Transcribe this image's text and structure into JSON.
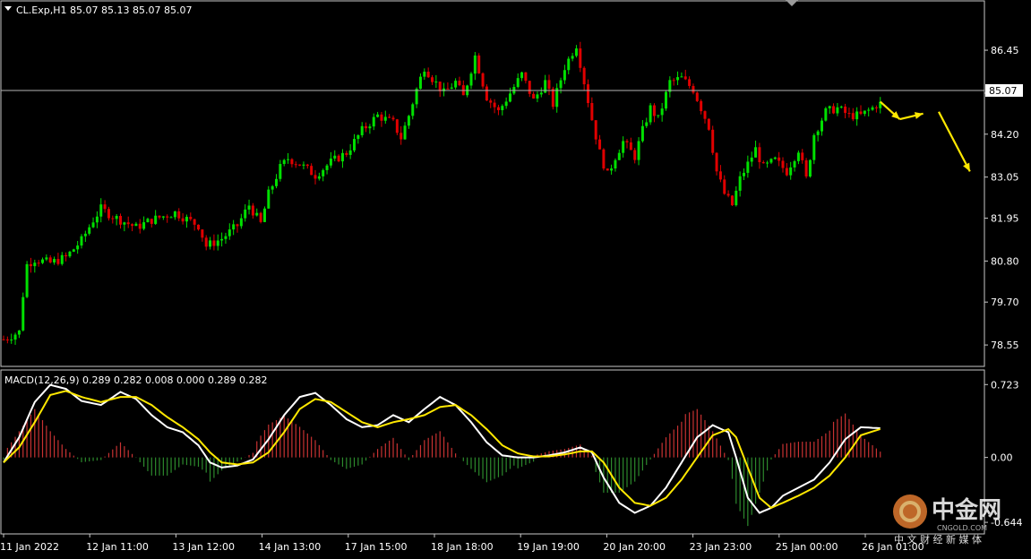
{
  "symbol_header": "CL.Exp,H1  85.07 85.13 85.07 85.07",
  "current_price_label": "85.07",
  "macd_header": "MACD(12,26,9) 0.289 0.282 0.008 0.000 0.289 0.282",
  "watermark": {
    "cn_text": "中金网",
    "sub_text": "CNGOLD.COM",
    "tagline": "中 文 财 经 新 媒 体"
  },
  "colors": {
    "background": "#000000",
    "bull_candle": "#00e000",
    "bear_candle": "#e00000",
    "macd_line": "#ffffff",
    "signal_line": "#ffe800",
    "hist_pos": "#c83232",
    "hist_neg": "#2d8a2d",
    "arrow": "#ffe800",
    "grid_text": "#ffffff"
  },
  "chart_data": [
    {
      "type": "candlestick",
      "price_axis_ticks": [
        "86.45",
        "85.30",
        "84.20",
        "83.05",
        "81.95",
        "80.80",
        "79.70",
        "78.55"
      ],
      "time_axis_labels": [
        "11 Jan 2022",
        "12 Jan 11:00",
        "13 Jan 12:00",
        "14 Jan 13:00",
        "17 Jan 15:00",
        "18 Jan 18:00",
        "19 Jan 19:00",
        "20 Jan 20:00",
        "23 Jan 23:00",
        "25 Jan 00:00",
        "26 Jan 01:00"
      ],
      "ylim": [
        78.0,
        87.7
      ],
      "current_price": 85.07,
      "close_path": [
        [
          0,
          78.7
        ],
        [
          4,
          78.9
        ],
        [
          5,
          79.9
        ],
        [
          6,
          80.7
        ],
        [
          8,
          80.85
        ],
        [
          12,
          80.75
        ],
        [
          16,
          80.9
        ],
        [
          20,
          81.35
        ],
        [
          23,
          81.9
        ],
        [
          25,
          82.2
        ],
        [
          28,
          82.0
        ],
        [
          34,
          81.7
        ],
        [
          38,
          81.9
        ],
        [
          44,
          82.1
        ],
        [
          50,
          81.75
        ],
        [
          52,
          81.2
        ],
        [
          56,
          81.4
        ],
        [
          60,
          81.75
        ],
        [
          63,
          82.3
        ],
        [
          66,
          81.8
        ],
        [
          68,
          82.6
        ],
        [
          71,
          83.3
        ],
        [
          73,
          83.55
        ],
        [
          76,
          83.4
        ],
        [
          80,
          83.1
        ],
        [
          84,
          83.45
        ],
        [
          88,
          83.7
        ],
        [
          92,
          84.3
        ],
        [
          96,
          84.7
        ],
        [
          100,
          84.5
        ],
        [
          102,
          84.1
        ],
        [
          104,
          84.7
        ],
        [
          106,
          85.4
        ],
        [
          108,
          86.0
        ],
        [
          110,
          85.7
        ],
        [
          113,
          85.3
        ],
        [
          116,
          85.6
        ],
        [
          118,
          85.2
        ],
        [
          121,
          86.3
        ],
        [
          124,
          85.2
        ],
        [
          127,
          84.8
        ],
        [
          130,
          85.3
        ],
        [
          133,
          85.8
        ],
        [
          136,
          85.1
        ],
        [
          139,
          85.6
        ],
        [
          141,
          85.0
        ],
        [
          144,
          86.0
        ],
        [
          147,
          86.6
        ],
        [
          149,
          85.6
        ],
        [
          151,
          84.6
        ],
        [
          153,
          83.7
        ],
        [
          155,
          83.1
        ],
        [
          157,
          83.6
        ],
        [
          159,
          84.0
        ],
        [
          162,
          83.6
        ],
        [
          164,
          84.3
        ],
        [
          166,
          84.9
        ],
        [
          168,
          84.6
        ],
        [
          171,
          85.6
        ],
        [
          174,
          85.7
        ],
        [
          177,
          85.4
        ],
        [
          181,
          84.4
        ],
        [
          183,
          83.2
        ],
        [
          185,
          82.6
        ],
        [
          187,
          82.3
        ],
        [
          189,
          83.0
        ],
        [
          191,
          83.4
        ],
        [
          193,
          83.8
        ],
        [
          195,
          83.3
        ],
        [
          198,
          83.5
        ],
        [
          201,
          83.2
        ],
        [
          204,
          83.8
        ],
        [
          206,
          83.0
        ],
        [
          208,
          84.2
        ],
        [
          211,
          84.8
        ],
        [
          214,
          84.9
        ],
        [
          217,
          84.7
        ],
        [
          220,
          84.7
        ],
        [
          223,
          84.9
        ],
        [
          225,
          85.07
        ]
      ],
      "up_days_count": 0,
      "forecast_arrows": [
        [
          [
            225,
            85.07
          ],
          [
            230,
            84.6
          ]
        ],
        [
          [
            230,
            84.6
          ],
          [
            236,
            84.75
          ]
        ],
        [
          [
            240,
            84.8
          ],
          [
            248,
            83.2
          ]
        ]
      ]
    },
    {
      "type": "macd",
      "ylim": [
        -0.75,
        0.85
      ],
      "axis_ticks": [
        "0.723",
        "0.00",
        "-0.644"
      ],
      "macd_path": [
        [
          0,
          -0.05
        ],
        [
          4,
          0.2
        ],
        [
          8,
          0.55
        ],
        [
          12,
          0.72
        ],
        [
          16,
          0.68
        ],
        [
          20,
          0.56
        ],
        [
          25,
          0.52
        ],
        [
          30,
          0.65
        ],
        [
          34,
          0.58
        ],
        [
          38,
          0.42
        ],
        [
          42,
          0.3
        ],
        [
          46,
          0.25
        ],
        [
          50,
          0.12
        ],
        [
          53,
          -0.05
        ],
        [
          56,
          -0.1
        ],
        [
          60,
          -0.08
        ],
        [
          64,
          -0.02
        ],
        [
          68,
          0.18
        ],
        [
          72,
          0.42
        ],
        [
          76,
          0.6
        ],
        [
          80,
          0.64
        ],
        [
          84,
          0.52
        ],
        [
          88,
          0.38
        ],
        [
          92,
          0.3
        ],
        [
          96,
          0.32
        ],
        [
          100,
          0.42
        ],
        [
          104,
          0.35
        ],
        [
          108,
          0.48
        ],
        [
          112,
          0.6
        ],
        [
          116,
          0.52
        ],
        [
          120,
          0.35
        ],
        [
          124,
          0.15
        ],
        [
          128,
          0.02
        ],
        [
          132,
          0.0
        ],
        [
          136,
          0.0
        ],
        [
          140,
          0.02
        ],
        [
          144,
          0.05
        ],
        [
          148,
          0.1
        ],
        [
          151,
          0.05
        ],
        [
          154,
          -0.2
        ],
        [
          158,
          -0.45
        ],
        [
          162,
          -0.55
        ],
        [
          166,
          -0.48
        ],
        [
          170,
          -0.3
        ],
        [
          174,
          -0.05
        ],
        [
          178,
          0.2
        ],
        [
          182,
          0.32
        ],
        [
          186,
          0.25
        ],
        [
          188,
          0.0
        ],
        [
          191,
          -0.4
        ],
        [
          194,
          -0.55
        ],
        [
          197,
          -0.5
        ],
        [
          200,
          -0.38
        ],
        [
          204,
          -0.3
        ],
        [
          208,
          -0.22
        ],
        [
          212,
          -0.05
        ],
        [
          216,
          0.18
        ],
        [
          220,
          0.3
        ],
        [
          225,
          0.29
        ]
      ],
      "signal_path": [
        [
          0,
          -0.05
        ],
        [
          4,
          0.1
        ],
        [
          8,
          0.35
        ],
        [
          12,
          0.62
        ],
        [
          16,
          0.66
        ],
        [
          20,
          0.6
        ],
        [
          25,
          0.55
        ],
        [
          30,
          0.6
        ],
        [
          34,
          0.6
        ],
        [
          38,
          0.52
        ],
        [
          42,
          0.4
        ],
        [
          46,
          0.3
        ],
        [
          50,
          0.18
        ],
        [
          53,
          0.05
        ],
        [
          56,
          -0.05
        ],
        [
          60,
          -0.07
        ],
        [
          64,
          -0.05
        ],
        [
          68,
          0.05
        ],
        [
          72,
          0.25
        ],
        [
          76,
          0.48
        ],
        [
          80,
          0.58
        ],
        [
          84,
          0.55
        ],
        [
          88,
          0.45
        ],
        [
          92,
          0.35
        ],
        [
          96,
          0.3
        ],
        [
          100,
          0.35
        ],
        [
          104,
          0.38
        ],
        [
          108,
          0.42
        ],
        [
          112,
          0.5
        ],
        [
          116,
          0.52
        ],
        [
          120,
          0.42
        ],
        [
          124,
          0.28
        ],
        [
          128,
          0.12
        ],
        [
          132,
          0.04
        ],
        [
          136,
          0.01
        ],
        [
          140,
          0.01
        ],
        [
          144,
          0.03
        ],
        [
          148,
          0.06
        ],
        [
          151,
          0.06
        ],
        [
          154,
          -0.05
        ],
        [
          158,
          -0.3
        ],
        [
          162,
          -0.45
        ],
        [
          166,
          -0.48
        ],
        [
          170,
          -0.4
        ],
        [
          174,
          -0.22
        ],
        [
          178,
          0.0
        ],
        [
          182,
          0.22
        ],
        [
          186,
          0.28
        ],
        [
          188,
          0.2
        ],
        [
          191,
          -0.1
        ],
        [
          194,
          -0.4
        ],
        [
          197,
          -0.5
        ],
        [
          200,
          -0.45
        ],
        [
          204,
          -0.38
        ],
        [
          208,
          -0.3
        ],
        [
          212,
          -0.18
        ],
        [
          216,
          0.0
        ],
        [
          220,
          0.22
        ],
        [
          225,
          0.282
        ]
      ]
    }
  ]
}
